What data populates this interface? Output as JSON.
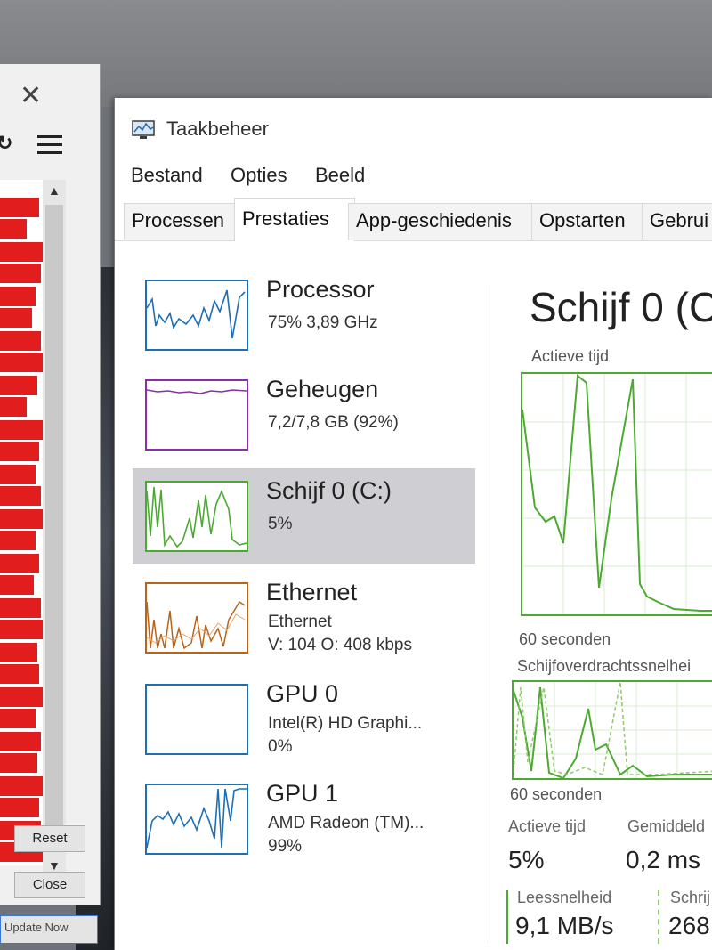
{
  "background_window": {
    "close_icon": "close-icon",
    "refresh_icon": "refresh-icon",
    "menu_icon": "hamburger-icon",
    "reset_label": "Reset",
    "close_label": "Close",
    "update_label": "Update Now"
  },
  "window": {
    "title": "Taakbeheer",
    "icon": "task-manager-icon"
  },
  "menu": [
    "Bestand",
    "Opties",
    "Beeld"
  ],
  "tabs": [
    "Processen",
    "Prestaties",
    "App-geschiedenis",
    "Opstarten",
    "Gebrui"
  ],
  "active_tab": "Prestaties",
  "sidebar": {
    "items": [
      {
        "name": "Processor",
        "line1": "75% 3,89 GHz",
        "line2": "",
        "line3": "",
        "color": "#1f6fb5"
      },
      {
        "name": "Geheugen",
        "line1": "7,2/7,8 GB (92%)",
        "line2": "",
        "line3": "",
        "color": "#8b2fa8"
      },
      {
        "name": "Schijf 0 (C:)",
        "line1": "5%",
        "line2": "",
        "line3": "",
        "color": "#4caa32"
      },
      {
        "name": "Ethernet",
        "line1": "Ethernet",
        "line2": "V: 104 O: 408 kbps",
        "line3": "",
        "color": "#b8641b"
      },
      {
        "name": "GPU 0",
        "line1": "Intel(R) HD Graphi...",
        "line2": "0%",
        "line3": "",
        "color": "#1f6fb5"
      },
      {
        "name": "GPU 1",
        "line1": "AMD Radeon (TM)...",
        "line2": "99%",
        "line3": "",
        "color": "#1f6fb5"
      }
    ],
    "selected_index": 2
  },
  "detail": {
    "title": "Schijf 0 (C",
    "graph1_label": "Actieve tijd",
    "graph1_footer": "60 seconden",
    "graph2_label": "Schijfoverdrachtssnelhei",
    "graph2_footer": "60 seconden",
    "stats": {
      "active_time_label": "Actieve tijd",
      "active_time_value": "5%",
      "avg_response_label": "Gemiddeld",
      "avg_response_value": "0,2 ms",
      "read_speed_label": "Leessnelheid",
      "read_speed_value": "9,1 MB/s",
      "write_speed_label": "Schrij",
      "write_speed_value": "268"
    },
    "accent_color": "#4caa32"
  }
}
